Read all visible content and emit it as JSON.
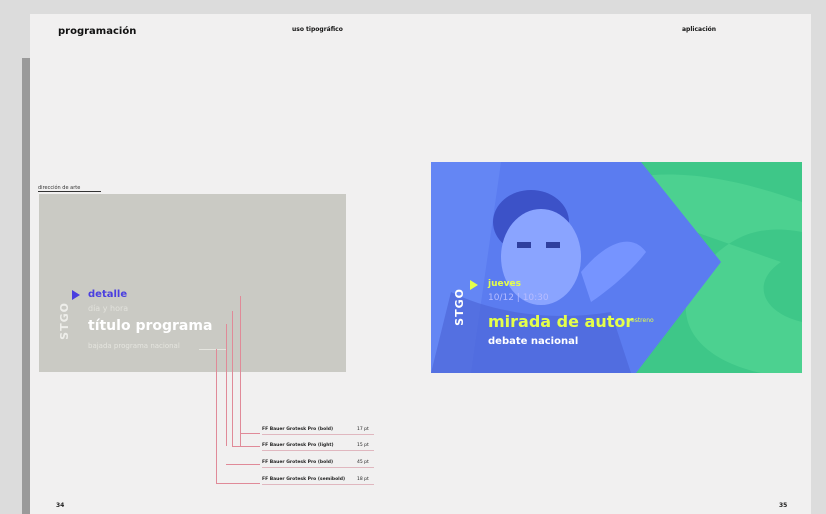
{
  "header": {
    "left_title": "programación",
    "center_title": "uso tipográfico",
    "right_title": "aplicación"
  },
  "page_numbers": {
    "left": "34",
    "right": "35"
  },
  "caption": "dirección de arte",
  "left_thumbnail": {
    "logo": "STGO",
    "tag": "detalle",
    "date": "día y hora",
    "title": "título programa",
    "subtitle": "bajada programa nacional"
  },
  "right_thumbnail": {
    "logo": "STGO",
    "tag": "jueves",
    "date": "10/12 | 10:30",
    "title": "mirada de autor",
    "badge": "estreno",
    "subtitle": "debate nacional"
  },
  "type_specs": [
    {
      "font": "FF Bauer Grotesk Pro (bold)",
      "size": "17 pt"
    },
    {
      "font": "FF Bauer Grotesk Pro (light)",
      "size": "15 pt"
    },
    {
      "font": "FF Bauer Grotesk Pro (bold)",
      "size": "45 pt"
    },
    {
      "font": "FF Bauer Grotesk Pro (semibold)",
      "size": "18 pt"
    }
  ],
  "colors": {
    "accent_blue": "#4a3fe0",
    "accent_yellow": "#e4ff4a",
    "photo_blue": "#5b7cf0",
    "photo_green": "#3ec788",
    "leader_pink": "#e08a98"
  }
}
